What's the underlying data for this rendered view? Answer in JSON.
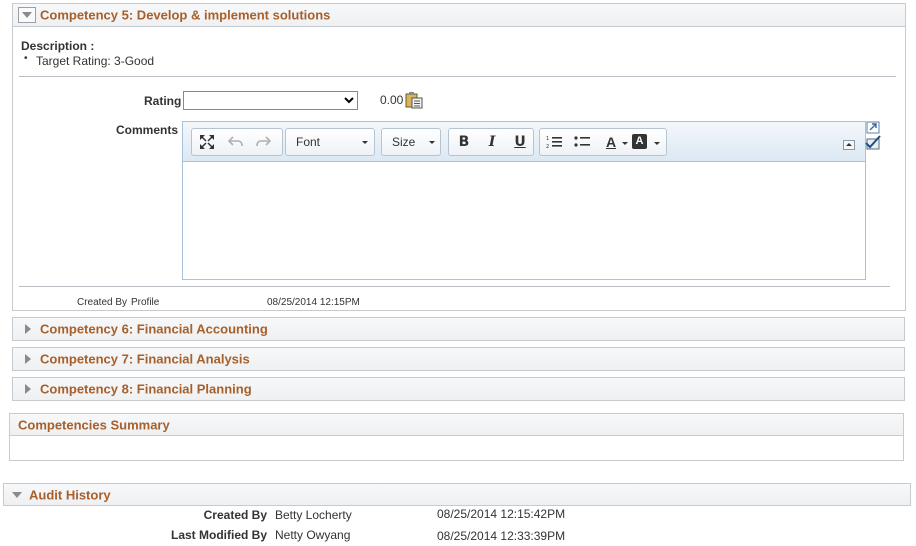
{
  "competency5": {
    "title": "Competency 5: Develop & implement solutions",
    "description_label": "Description :",
    "target_rating": "Target Rating: 3-Good",
    "rating_label": "Rating",
    "rating_selected": "",
    "rating_score": "0.00",
    "comments_label": "Comments",
    "editor": {
      "font_label": "Font",
      "size_label": "Size",
      "bold": "B",
      "italic": "I",
      "underline": "U",
      "text_color_glyph": "A",
      "bg_color_glyph": "A"
    },
    "created_by_label": "Created By",
    "created_by_value": "Profile",
    "created_at": "08/25/2014 12:15PM"
  },
  "collapsed_sections": [
    {
      "title": "Competency 6: Financial Accounting"
    },
    {
      "title": "Competency 7: Financial Analysis"
    },
    {
      "title": "Competency 8: Financial Planning"
    }
  ],
  "summary": {
    "title": "Competencies Summary"
  },
  "audit": {
    "title": "Audit History",
    "created_by_label": "Created By",
    "created_by_value": "Betty Locherty",
    "created_at": "08/25/2014 12:15:42PM",
    "modified_by_label": "Last Modified By",
    "modified_by_value": "Netty Owyang",
    "modified_at": "08/25/2014 12:33:39PM"
  },
  "colors": {
    "accent": "#a8602a",
    "border": "#c6cbd0",
    "editor_border": "#a7c2d9"
  }
}
